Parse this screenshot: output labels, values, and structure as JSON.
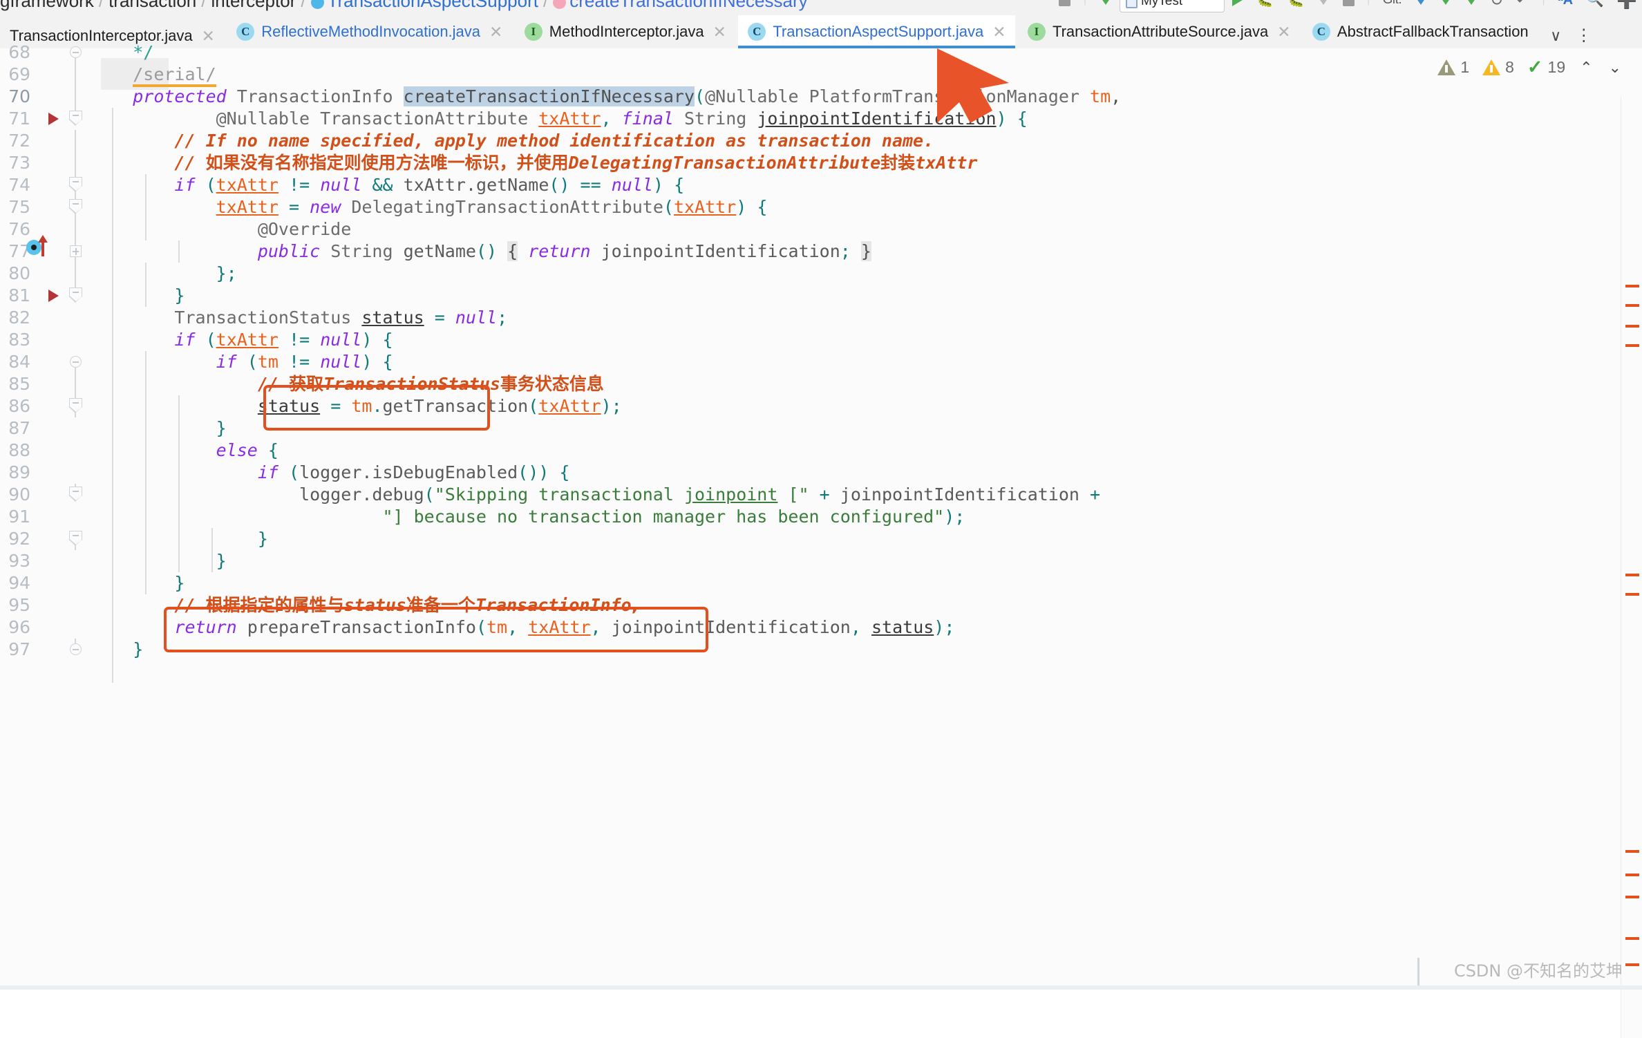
{
  "breadcrumb": {
    "items": [
      {
        "label": "gframework",
        "type": "pkg"
      },
      {
        "label": "transaction",
        "type": "pkg"
      },
      {
        "label": "interceptor",
        "type": "pkg"
      },
      {
        "label": "TransactionAspectSupport",
        "type": "class"
      },
      {
        "label": "createTransactionIfNecessary",
        "type": "method"
      }
    ],
    "separator": "/"
  },
  "toolbar": {
    "run_config_label": "MyTest",
    "run_icon": "run-triangle-icon",
    "stop_icon": "stop-square-icon",
    "debug_icon": "debug-bug-icon",
    "git_label": "Git:",
    "update_icon": "update-project-icon",
    "commit_icon": "commit-icon",
    "push_icon": "push-icon",
    "history_icon": "history-icon",
    "undo_icon": "undo-icon",
    "translate_icon": "translate-icon",
    "search_icon": "search-icon",
    "add_icon": "plus-icon"
  },
  "tabs": [
    {
      "label": "TransactionInterceptor.java",
      "icon": "class-icon",
      "icon_kind": "cls",
      "icon_letter": "C",
      "active": false,
      "show_icon": false,
      "closable": true
    },
    {
      "label": "ReflectiveMethodInvocation.java",
      "icon": "class-icon",
      "icon_kind": "cls",
      "icon_letter": "C",
      "active": false,
      "show_icon": true,
      "closable": true
    },
    {
      "label": "MethodInterceptor.java",
      "icon": "interface-icon",
      "icon_kind": "iface",
      "icon_letter": "I",
      "active": false,
      "show_icon": true,
      "closable": true
    },
    {
      "label": "TransactionAspectSupport.java",
      "icon": "class-icon",
      "icon_kind": "cls",
      "icon_letter": "C",
      "active": true,
      "show_icon": true,
      "closable": true
    },
    {
      "label": "TransactionAttributeSource.java",
      "icon": "interface-icon",
      "icon_kind": "iface",
      "icon_letter": "I",
      "active": false,
      "show_icon": true,
      "closable": true
    },
    {
      "label": "AbstractFallbackTransaction",
      "icon": "class-icon",
      "icon_kind": "cls",
      "icon_letter": "C",
      "active": false,
      "show_icon": true,
      "closable": false
    }
  ],
  "tab_overflow_label": "∨",
  "tab_menu_label": "⋮",
  "inspection": {
    "weak_warning_count": "1",
    "warning_count": "8",
    "ok_count": "19",
    "up_caret": "⌃",
    "down_caret": "⌄"
  },
  "editor": {
    "first_line": 68,
    "lines": [
      {
        "no": "68",
        "text": "    */"
      },
      {
        "no": "69",
        "text": "    /serial/"
      },
      {
        "no": "70",
        "text": "    protected TransactionInfo createTransactionIfNecessary(@Nullable PlatformTransactionManager tm,"
      },
      {
        "no": "71",
        "text": "            @Nullable TransactionAttribute txAttr, final String joinpointIdentification) {"
      },
      {
        "no": "72",
        "text": "        // If no name specified, apply method identification as transaction name."
      },
      {
        "no": "73",
        "text": "        // 如果没有名称指定则使用方法唯一标识，并使用DelegatingTransactionAttribute封装txAttr"
      },
      {
        "no": "74",
        "text": "        if (txAttr != null && txAttr.getName() == null) {"
      },
      {
        "no": "75",
        "text": "            txAttr = new DelegatingTransactionAttribute(txAttr) {"
      },
      {
        "no": "76",
        "text": "                @Override"
      },
      {
        "no": "77",
        "text": "                public String getName() { return joinpointIdentification; }"
      },
      {
        "no": "80",
        "text": "            };"
      },
      {
        "no": "81",
        "text": "        }"
      },
      {
        "no": "82",
        "text": "        TransactionStatus status = null;"
      },
      {
        "no": "83",
        "text": "        if (txAttr != null) {"
      },
      {
        "no": "84",
        "text": "            if (tm != null) {"
      },
      {
        "no": "85",
        "text": "                // 获取TransactionStatus事务状态信息"
      },
      {
        "no": "86",
        "text": "                status = tm.getTransaction(txAttr);"
      },
      {
        "no": "87",
        "text": "            }"
      },
      {
        "no": "88",
        "text": "            else {"
      },
      {
        "no": "89",
        "text": "                if (logger.isDebugEnabled()) {"
      },
      {
        "no": "90",
        "text": "                    logger.debug(\"Skipping transactional joinpoint [\" + joinpointIdentification +"
      },
      {
        "no": "91",
        "text": "                            \"] because no transaction manager has been configured\");"
      },
      {
        "no": "92",
        "text": "                }"
      },
      {
        "no": "93",
        "text": "            }"
      },
      {
        "no": "94",
        "text": "        }"
      },
      {
        "no": "95",
        "text": "        // 根据指定的属性与status准备一个TransactionInfo,"
      },
      {
        "no": "96",
        "text": "        return prepareTransactionInfo(tm, txAttr, joinpointIdentification, status);"
      },
      {
        "no": "97",
        "text": "    }"
      }
    ],
    "current_line": "70",
    "selected_token": "createTransactionIfNecessary",
    "highlight_boxes": [
      {
        "label": "getTransaction(txAttr);",
        "line": "86"
      },
      {
        "label": "prepareTransactionInfo(tm, txAttr, joinpointIdentification, status);",
        "line": "96"
      }
    ]
  },
  "colors": {
    "accent_box": "#e2511d",
    "arrow": "#e8532a",
    "tab_active_underline": "#3f8fd0",
    "comment": "#d1501a",
    "keyword": "#8a2be2",
    "field": "#e8621e",
    "string": "#3a7d3a",
    "selection": "#bed2e6"
  },
  "watermark": "CSDN @不知名的艾坤"
}
